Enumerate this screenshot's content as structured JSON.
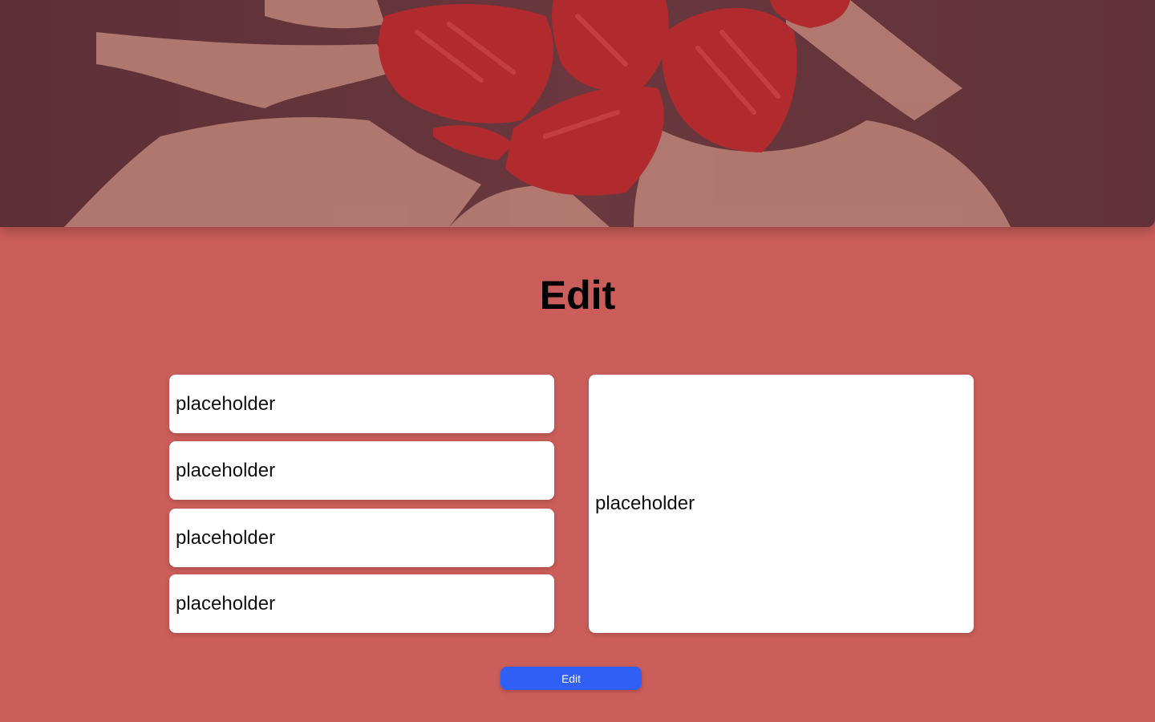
{
  "page": {
    "title": "Edit",
    "hero_image": "hands-painted-red-photo",
    "accent_color": "#cb5d5a",
    "button_color": "#2f5ff5"
  },
  "form": {
    "fields": [
      {
        "placeholder": "placeholder"
      },
      {
        "placeholder": "placeholder"
      },
      {
        "placeholder": "placeholder"
      },
      {
        "placeholder": "placeholder"
      }
    ],
    "textarea": {
      "placeholder": "placeholder"
    }
  },
  "actions": {
    "edit_label": "Edit"
  }
}
